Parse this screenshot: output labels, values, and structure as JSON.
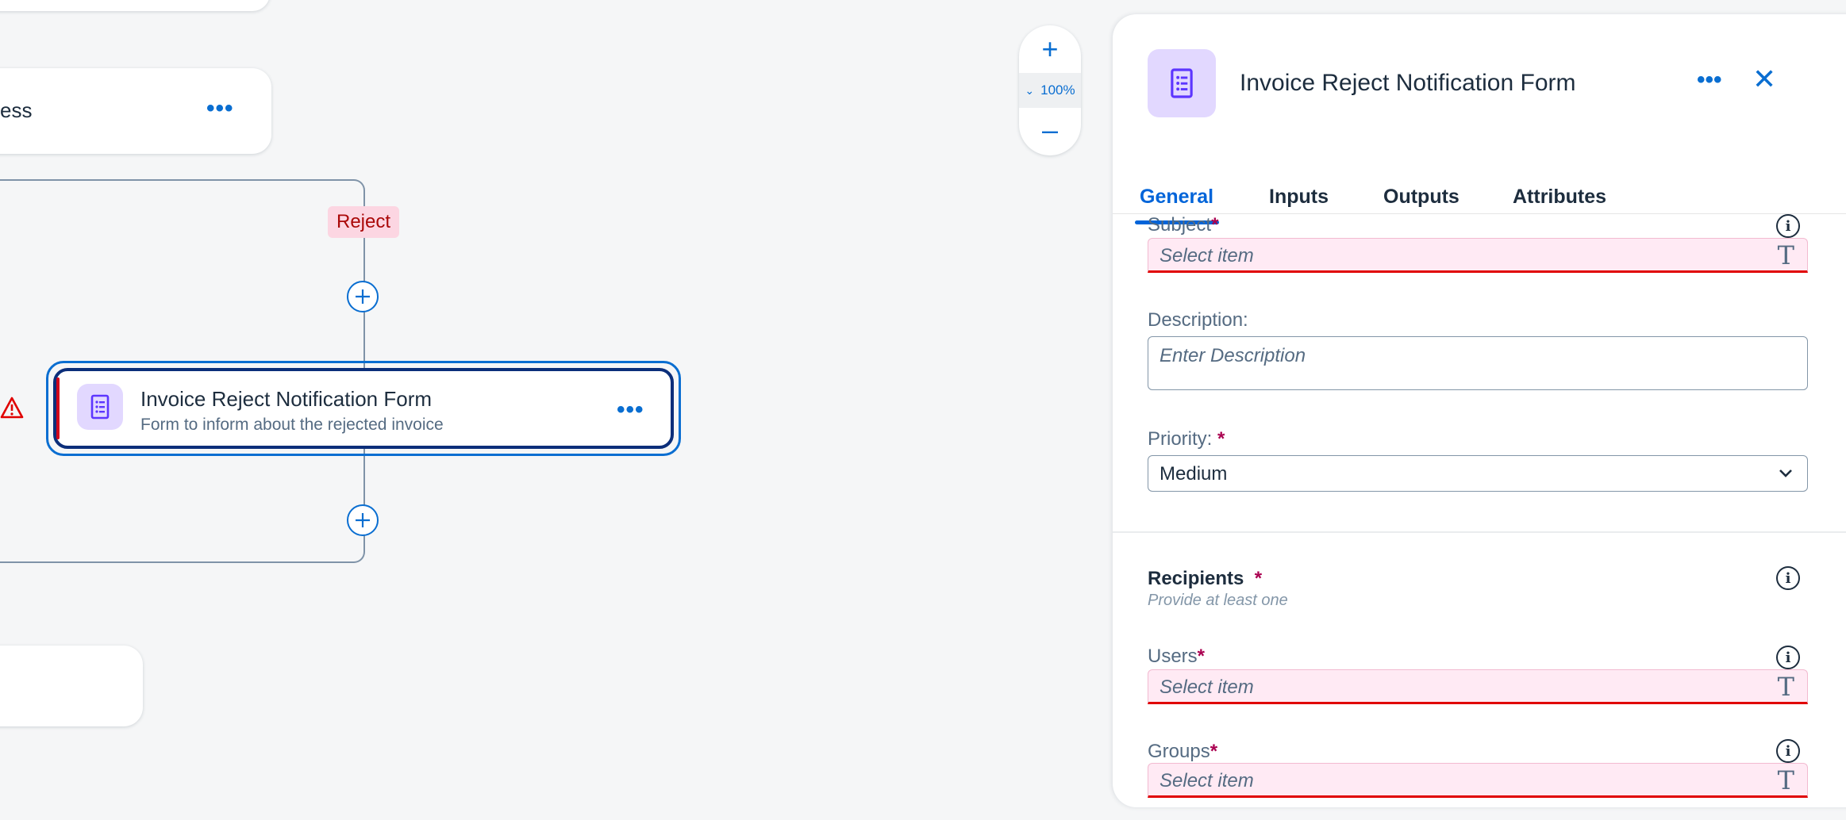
{
  "canvas": {
    "top_node_partial_label": "ess",
    "reject_label": "Reject",
    "selected_node": {
      "title": "Invoice Reject Notification Form",
      "subtitle": "Form to inform about the rejected invoice"
    }
  },
  "zoom": {
    "plus": "+",
    "level": "100%",
    "chevron": "⌄",
    "minus": "–"
  },
  "panel": {
    "title": "Invoice Reject Notification Form",
    "more": "•••",
    "close": "✕",
    "tabs": [
      {
        "label": "General"
      },
      {
        "label": "Inputs"
      },
      {
        "label": "Outputs"
      },
      {
        "label": "Attributes"
      }
    ],
    "subject": {
      "label": "Subject",
      "required": "*",
      "placeholder": "Select item"
    },
    "description": {
      "label": "Description:",
      "placeholder": "Enter Description"
    },
    "priority": {
      "label": "Priority:",
      "required": "*",
      "value": "Medium"
    },
    "recipients": {
      "title": "Recipients",
      "required": "*",
      "hint": "Provide at least one"
    },
    "users": {
      "label": "Users",
      "required": "*",
      "placeholder": "Select item"
    },
    "groups": {
      "label": "Groups",
      "required": "*",
      "placeholder": "Select item"
    },
    "info_glyph": "i",
    "text_type_glyph": "T"
  },
  "colors": {
    "accent": "#0a6ed1",
    "error": "#e00000",
    "required": "#aa0050",
    "form_icon_bg": "#e2d8ff"
  }
}
